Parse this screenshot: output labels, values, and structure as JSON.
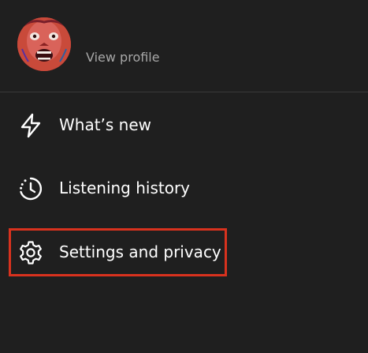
{
  "profile": {
    "avatar_icon": "avatar-screaming-face-image",
    "view_profile_label": "View profile"
  },
  "menu": {
    "items": [
      {
        "label": "What’s new",
        "icon": "lightning-bolt-icon"
      },
      {
        "label": "Listening history",
        "icon": "clock-history-icon"
      },
      {
        "label": "Settings and privacy",
        "icon": "gear-icon"
      }
    ]
  },
  "colors": {
    "background": "#1f1f1f",
    "secondary_text": "#a7a7a7",
    "divider": "#3a3a3a",
    "highlight": "#d8321e"
  }
}
